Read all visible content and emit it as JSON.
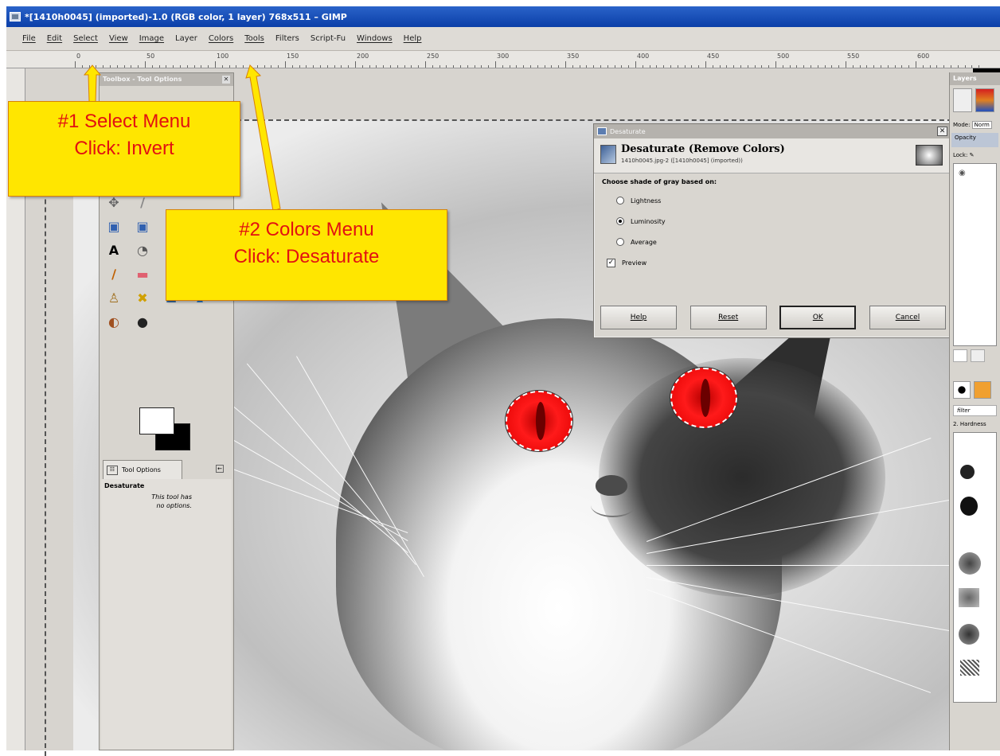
{
  "window": {
    "title": "*[1410h0045] (imported)-1.0 (RGB color, 1 layer) 768x511 – GIMP"
  },
  "menubar": [
    "File",
    "Edit",
    "Select",
    "View",
    "Image",
    "Layer",
    "Colors",
    "Tools",
    "Filters",
    "Script-Fu",
    "Windows",
    "Help"
  ],
  "ruler": {
    "labels": [
      "0",
      "50",
      "100",
      "150",
      "200",
      "250",
      "300",
      "350",
      "400",
      "450",
      "500",
      "550",
      "600"
    ]
  },
  "toolbox": {
    "title": "Toolbox - Tool Options",
    "close": "✕",
    "tools": [
      {
        "name": "move-tool-icon",
        "glyph": "✥",
        "color": "#666"
      },
      {
        "name": "measure-tool-icon",
        "glyph": "∕",
        "color": "#888"
      },
      {
        "name": "blank-tool-1",
        "glyph": "",
        "color": "#666"
      },
      {
        "name": "blank-tool-2",
        "glyph": "",
        "color": "#666"
      },
      {
        "name": "perspective-tool-icon",
        "glyph": "▣",
        "color": "#3060b0"
      },
      {
        "name": "flip-tool-icon",
        "glyph": "▣",
        "color": "#3060b0"
      },
      {
        "name": "blank-tool-3",
        "glyph": "",
        "color": "#666"
      },
      {
        "name": "blank-tool-4",
        "glyph": "",
        "color": "#666"
      },
      {
        "name": "text-tool-icon",
        "glyph": "A",
        "color": "#000"
      },
      {
        "name": "color-picker-tool-icon",
        "glyph": "◔",
        "color": "#555"
      },
      {
        "name": "blank-tool-5",
        "glyph": "",
        "color": "#666"
      },
      {
        "name": "blank-tool-6",
        "glyph": "",
        "color": "#666"
      },
      {
        "name": "paintbrush-tool-icon",
        "glyph": "∕",
        "color": "#c06000"
      },
      {
        "name": "eraser-tool-icon",
        "glyph": "▬",
        "color": "#e06070"
      },
      {
        "name": "airbrush-tool-icon",
        "glyph": "✖",
        "color": "#3a7a3a"
      },
      {
        "name": "ink-tool-icon",
        "glyph": "▲",
        "color": "#3c4f7a"
      },
      {
        "name": "clone-tool-icon",
        "glyph": "♙",
        "color": "#a07020"
      },
      {
        "name": "heal-tool-icon",
        "glyph": "✖",
        "color": "#d0a000"
      },
      {
        "name": "perspective-clone-icon",
        "glyph": "☗",
        "color": "#3a6aa0"
      },
      {
        "name": "blur-tool-icon",
        "glyph": "▴",
        "color": "#2070c0"
      },
      {
        "name": "smudge-tool-icon",
        "glyph": "◐",
        "color": "#a05020"
      },
      {
        "name": "dodge-burn-tool-icon",
        "glyph": "●",
        "color": "#222"
      }
    ],
    "tab_label": "Tool Options",
    "tab_close": "←",
    "options_title": "Desaturate",
    "options_text": [
      "This tool has",
      "no options."
    ]
  },
  "dialog": {
    "title": "Desaturate",
    "close": "✕",
    "header_title": "Desaturate (Remove Colors)",
    "header_sub": "1410h0045.jpg-2 ([1410h0045] (imported))",
    "prompt": "Choose shade of gray based on:",
    "options": [
      {
        "label": "Lightness",
        "selected": false
      },
      {
        "label": "Luminosity",
        "selected": true
      },
      {
        "label": "Average",
        "selected": false
      }
    ],
    "preview_label": "Preview",
    "preview_checked": true,
    "buttons": {
      "help": "Help",
      "reset": "Reset",
      "ok": "OK",
      "cancel": "Cancel"
    }
  },
  "layers": {
    "title": "Layers",
    "mode_label": "Mode:",
    "mode_value": "Norm",
    "opacity_label": "Opacity",
    "lock_label": "Lock:",
    "filter_label": "filter",
    "brush_label": "2. Hardness"
  },
  "callouts": [
    {
      "line1": "#1 Select Menu",
      "line2": "Click: Invert"
    },
    {
      "line1": "#2 Colors Menu",
      "line2": "Click: Desaturate"
    }
  ],
  "colors": {
    "callout_bg": "#ffe600",
    "callout_text": "#e21111",
    "arrow": "#d98200",
    "eye_red": "#ff1a1a"
  }
}
